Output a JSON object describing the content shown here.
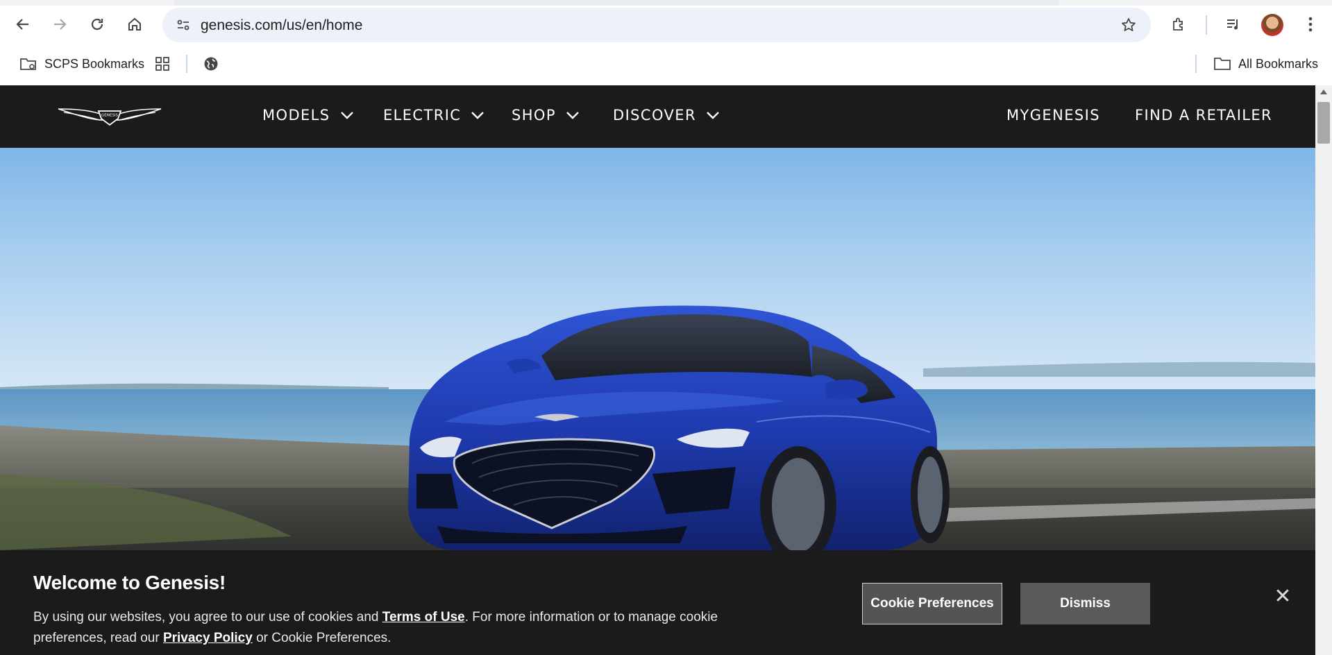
{
  "browser": {
    "url": "genesis.com/us/en/home",
    "bookmarks": {
      "folder_label": "SCPS Bookmarks",
      "all_label": "All Bookmarks"
    }
  },
  "site": {
    "nav": {
      "models": "MODELS",
      "electric": "ELECTRIC",
      "shop": "SHOP",
      "discover": "DISCOVER",
      "mygenesis": "MYGENESIS",
      "retailer": "FIND A RETAILER"
    },
    "logo_text": "GENESIS"
  },
  "cookie": {
    "title": "Welcome to Genesis!",
    "text_1": "By using our websites, you agree to our use of cookies and ",
    "terms_link": "Terms of Use",
    "text_2": ". For more information or to manage cookie preferences, read our ",
    "privacy_link": "Privacy Policy",
    "text_3": " or Cookie Preferences.",
    "preferences_button": "Cookie Preferences",
    "dismiss_button": "Dismiss",
    "close_symbol": "✕"
  },
  "colors": {
    "nav_bg": "#1b1b1b",
    "car_blue": "#1f3bb0"
  }
}
